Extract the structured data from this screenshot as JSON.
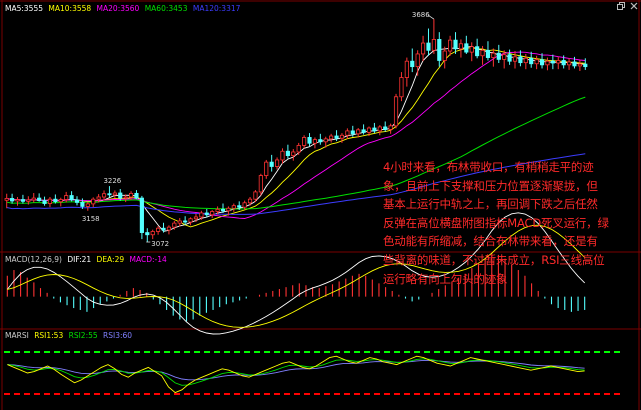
{
  "colors": {
    "ma5": "#ffffff",
    "ma10": "#ffff00",
    "ma20": "#ff00ff",
    "ma60": "#00e000",
    "ma120": "#3c3cff",
    "up": "#ff3333",
    "down": "#54ffff",
    "dif": "#ffffff",
    "dea": "#ffff00",
    "rsi1": "#ffff00",
    "rsi2": "#00e000",
    "rsi3": "#8080ff",
    "dash_high": "#00ff00",
    "dash_low": "#ff0000",
    "grid": "#7a0000",
    "annotation": "#ff2a2a"
  },
  "icons": [
    "window-restore-icon",
    "window-close-icon"
  ],
  "legend_main": {
    "ma5": "MA5:3555",
    "ma10": "MA10:3558",
    "ma20": "MA20:3560",
    "ma60": "MA60:3453",
    "ma120": "MA120:3317"
  },
  "legend_macd": {
    "title": "MACD(12,26,9)",
    "dif": "DIF:21",
    "dea": "DEA:29",
    "macd": "MACD:-14"
  },
  "legend_rsi": {
    "title": "MARSI",
    "rsi1": "RSI1:53",
    "rsi2": "RSI2:55",
    "rsi3": "RSI3:60"
  },
  "price_labels": {
    "high": "3686",
    "mid_high": "3226",
    "low1": "3158",
    "low2": "3072"
  },
  "annotation": [
    "4小时来看，布林带收口，有稍稍走平的迹",
    "象，且前上下支撑和压力位置逐渐聚拢，但",
    "基本上运行中轨之上，再回调下跌之后任然",
    "反弹在高位横盘附图指标MACD死叉运行，绿",
    "色动能有所缩减，结合布林带来看，还是有",
    "些背离的味道，不过暂未成立，RSI三线高位",
    "运行略有向上勾头的迹象"
  ],
  "chart_data": {
    "type": "candlestick",
    "ohlc_samples": [
      [
        3187,
        3205,
        3165,
        3192
      ],
      [
        3192,
        3205,
        3178,
        3185
      ],
      [
        3185,
        3196,
        3172,
        3189
      ],
      [
        3189,
        3202,
        3178,
        3184
      ],
      [
        3184,
        3198,
        3175,
        3188
      ],
      [
        3188,
        3207,
        3181,
        3193
      ],
      [
        3193,
        3206,
        3183,
        3186
      ],
      [
        3186,
        3197,
        3172,
        3178
      ],
      [
        3178,
        3196,
        3168,
        3190
      ],
      [
        3190,
        3203,
        3178,
        3183
      ],
      [
        3183,
        3194,
        3170,
        3189
      ],
      [
        3189,
        3210,
        3181,
        3200
      ],
      [
        3200,
        3212,
        3184,
        3188
      ],
      [
        3188,
        3198,
        3173,
        3181
      ],
      [
        3181,
        3192,
        3163,
        3170
      ],
      [
        3170,
        3182,
        3158,
        3177
      ],
      [
        3177,
        3195,
        3168,
        3190
      ],
      [
        3190,
        3204,
        3181,
        3196
      ],
      [
        3196,
        3214,
        3186,
        3205
      ],
      [
        3205,
        3226,
        3195,
        3202
      ],
      [
        3202,
        3214,
        3192,
        3207
      ],
      [
        3207,
        3218,
        3186,
        3193
      ],
      [
        3193,
        3203,
        3182,
        3196
      ],
      [
        3196,
        3212,
        3188,
        3206
      ],
      [
        3206,
        3215,
        3190,
        3193
      ],
      [
        3193,
        3199,
        3080,
        3098
      ],
      [
        3098,
        3110,
        3072,
        3092
      ],
      [
        3092,
        3106,
        3080,
        3101
      ],
      [
        3101,
        3116,
        3092,
        3110
      ],
      [
        3110,
        3125,
        3098,
        3105
      ],
      [
        3105,
        3118,
        3093,
        3113
      ],
      [
        3113,
        3130,
        3106,
        3124
      ],
      [
        3124,
        3138,
        3115,
        3130
      ],
      [
        3130,
        3143,
        3119,
        3127
      ],
      [
        3127,
        3140,
        3118,
        3136
      ],
      [
        3136,
        3150,
        3127,
        3141
      ],
      [
        3141,
        3158,
        3133,
        3152
      ],
      [
        3152,
        3163,
        3140,
        3147
      ],
      [
        3147,
        3160,
        3138,
        3156
      ],
      [
        3156,
        3170,
        3148,
        3162
      ],
      [
        3162,
        3178,
        3152,
        3158
      ],
      [
        3158,
        3170,
        3145,
        3165
      ],
      [
        3165,
        3178,
        3155,
        3172
      ],
      [
        3172,
        3184,
        3160,
        3168
      ],
      [
        3168,
        3186,
        3160,
        3180
      ],
      [
        3180,
        3196,
        3172,
        3190
      ],
      [
        3190,
        3215,
        3182,
        3210
      ],
      [
        3210,
        3260,
        3200,
        3255
      ],
      [
        3255,
        3298,
        3246,
        3292
      ],
      [
        3292,
        3312,
        3266,
        3280
      ],
      [
        3280,
        3305,
        3272,
        3298
      ],
      [
        3298,
        3330,
        3288,
        3322
      ],
      [
        3322,
        3340,
        3302,
        3310
      ],
      [
        3310,
        3328,
        3296,
        3320
      ],
      [
        3320,
        3345,
        3312,
        3338
      ],
      [
        3338,
        3366,
        3330,
        3360
      ],
      [
        3360,
        3372,
        3336,
        3344
      ],
      [
        3344,
        3360,
        3330,
        3354
      ],
      [
        3354,
        3370,
        3340,
        3348
      ],
      [
        3348,
        3362,
        3332,
        3356
      ],
      [
        3356,
        3370,
        3346,
        3364
      ],
      [
        3364,
        3380,
        3350,
        3358
      ],
      [
        3358,
        3372,
        3345,
        3366
      ],
      [
        3366,
        3385,
        3356,
        3378
      ],
      [
        3378,
        3392,
        3362,
        3370
      ],
      [
        3370,
        3386,
        3360,
        3381
      ],
      [
        3381,
        3396,
        3368,
        3374
      ],
      [
        3374,
        3390,
        3364,
        3386
      ],
      [
        3386,
        3400,
        3372,
        3378
      ],
      [
        3378,
        3394,
        3366,
        3389
      ],
      [
        3389,
        3404,
        3376,
        3382
      ],
      [
        3382,
        3398,
        3370,
        3392
      ],
      [
        3392,
        3480,
        3385,
        3472
      ],
      [
        3472,
        3540,
        3460,
        3525
      ],
      [
        3525,
        3580,
        3500,
        3570
      ],
      [
        3570,
        3605,
        3540,
        3555
      ],
      [
        3555,
        3600,
        3530,
        3590
      ],
      [
        3590,
        3640,
        3570,
        3620
      ],
      [
        3620,
        3660,
        3585,
        3600
      ],
      [
        3600,
        3686,
        3590,
        3630
      ],
      [
        3630,
        3650,
        3555,
        3572
      ],
      [
        3572,
        3610,
        3550,
        3598
      ],
      [
        3598,
        3640,
        3585,
        3628
      ],
      [
        3628,
        3650,
        3590,
        3604
      ],
      [
        3604,
        3630,
        3580,
        3618
      ],
      [
        3618,
        3640,
        3590,
        3595
      ],
      [
        3595,
        3622,
        3570,
        3610
      ],
      [
        3610,
        3632,
        3578,
        3585
      ],
      [
        3585,
        3612,
        3560,
        3600
      ],
      [
        3600,
        3625,
        3572,
        3580
      ],
      [
        3580,
        3605,
        3555,
        3592
      ],
      [
        3592,
        3615,
        3565,
        3575
      ],
      [
        3575,
        3600,
        3550,
        3588
      ],
      [
        3588,
        3602,
        3560,
        3570
      ],
      [
        3570,
        3598,
        3550,
        3582
      ],
      [
        3582,
        3600,
        3556,
        3566
      ],
      [
        3566,
        3590,
        3548,
        3578
      ],
      [
        3578,
        3596,
        3552,
        3563
      ],
      [
        3563,
        3585,
        3548,
        3574
      ],
      [
        3574,
        3592,
        3550,
        3560
      ],
      [
        3560,
        3580,
        3545,
        3570
      ],
      [
        3570,
        3588,
        3548,
        3565
      ],
      [
        3565,
        3582,
        3548,
        3572
      ],
      [
        3572,
        3586,
        3550,
        3560
      ],
      [
        3560,
        3578,
        3546,
        3568
      ],
      [
        3568,
        3582,
        3550,
        3557
      ],
      [
        3557,
        3572,
        3543,
        3562
      ],
      [
        3562,
        3578,
        3546,
        3555
      ]
    ],
    "macd_hist_samples": [
      22,
      28,
      26,
      20,
      15,
      9,
      4,
      -2,
      -6,
      -9,
      -12,
      -14,
      -16,
      -12,
      -8,
      -5,
      -2,
      2,
      6,
      9,
      7,
      4,
      -3,
      -8,
      -14,
      -20,
      -24,
      -26,
      -24,
      -20,
      -17,
      -14,
      -11,
      -8,
      -6,
      -4,
      -2,
      0,
      2,
      4,
      6,
      8,
      10,
      12,
      14,
      12,
      10,
      9,
      11,
      13,
      16,
      19,
      22,
      24,
      22,
      18,
      14,
      10,
      6,
      2,
      -2,
      -5,
      -3,
      0,
      4,
      8,
      12,
      16,
      20,
      24,
      30,
      34,
      40,
      46,
      44,
      40,
      34,
      28,
      22,
      14,
      6,
      -2,
      -8,
      -12,
      -14,
      -16,
      -15,
      -14
    ],
    "rsi1_samples": [
      62,
      58,
      54,
      50,
      52,
      56,
      60,
      55,
      48,
      42,
      36,
      40,
      46,
      52,
      58,
      62,
      56,
      48,
      44,
      50,
      54,
      58,
      52,
      46,
      30,
      22,
      26,
      34,
      40,
      44,
      48,
      52,
      56,
      54,
      50,
      46,
      44,
      48,
      52,
      56,
      60,
      64,
      66,
      62,
      58,
      56,
      60,
      66,
      72,
      74,
      70,
      66,
      64,
      68,
      72,
      70,
      66,
      64,
      62,
      66,
      70,
      74,
      72,
      68,
      64,
      62,
      60,
      64,
      68,
      72,
      70,
      68,
      66,
      64,
      62,
      60,
      58,
      56,
      54,
      56,
      58,
      60,
      58,
      56,
      54,
      52,
      53
    ],
    "rsi_dash_levels": [
      80,
      20
    ],
    "rsi_ylim": [
      0,
      100
    ]
  }
}
